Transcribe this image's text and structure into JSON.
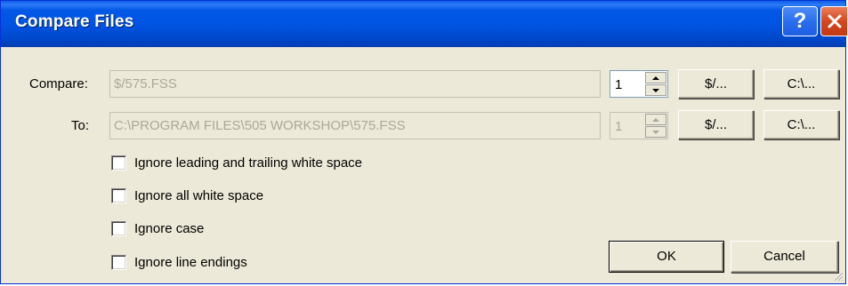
{
  "window": {
    "title": "Compare Files",
    "help_glyph": "?",
    "close_glyph": "✕"
  },
  "compare": {
    "label": "Compare:",
    "path": "$/575.FSS",
    "version": "1",
    "browse_project_label": "$/...",
    "browse_local_label": "C:\\..."
  },
  "to": {
    "label": "To:",
    "path": "C:\\PROGRAM FILES\\505 WORKSHOP\\575.FSS",
    "version": "1",
    "browse_project_label": "$/...",
    "browse_local_label": "C:\\..."
  },
  "options": [
    {
      "label": "Ignore leading and trailing white space",
      "checked": false
    },
    {
      "label": "Ignore all white space",
      "checked": false
    },
    {
      "label": "Ignore case",
      "checked": false
    },
    {
      "label": "Ignore line endings",
      "checked": false
    }
  ],
  "buttons": {
    "ok_label": "OK",
    "cancel_label": "Cancel"
  },
  "colors": {
    "titlebar": "#0054e3",
    "dialog_bg": "#ece9d8",
    "close_button": "#d8461e",
    "disabled_text": "#aca899"
  }
}
